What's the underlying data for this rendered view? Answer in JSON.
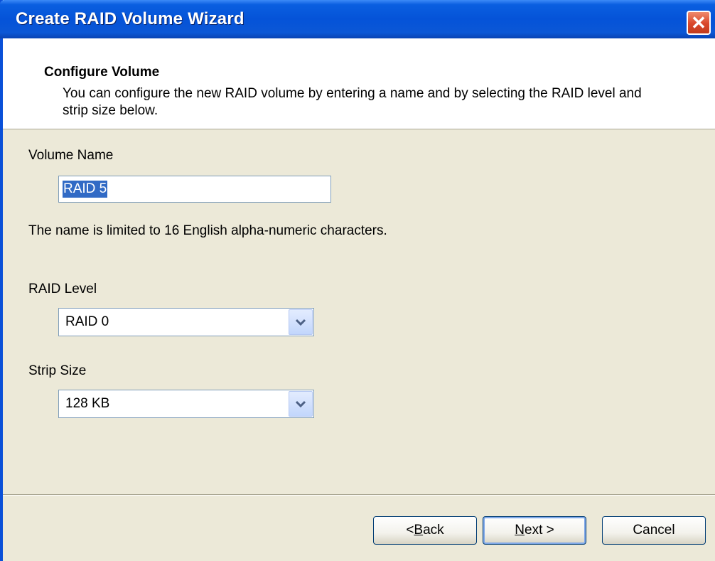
{
  "window": {
    "title": "Create RAID Volume Wizard",
    "close_glyph": "✕"
  },
  "header": {
    "title": "Configure Volume",
    "description": "You can configure the new RAID volume by entering a name and by selecting the RAID level and strip size below."
  },
  "volume_name": {
    "label": "Volume Name",
    "value": "RAID 5",
    "hint": "The name is limited to 16 English alpha-numeric characters."
  },
  "raid_level": {
    "label": "RAID Level",
    "selected": "RAID 0"
  },
  "strip_size": {
    "label": "Strip Size",
    "selected": "128 KB"
  },
  "buttons": {
    "back_mnemonic": "B",
    "back_rest": "ack",
    "back_prefix": "< ",
    "next_mnemonic": "N",
    "next_rest": "ext >",
    "cancel": "Cancel"
  },
  "colors": {
    "titlebar": "#0553d8",
    "dialog_bg": "#ece9d8",
    "selection": "#316ac5",
    "close": "#d9472a"
  }
}
